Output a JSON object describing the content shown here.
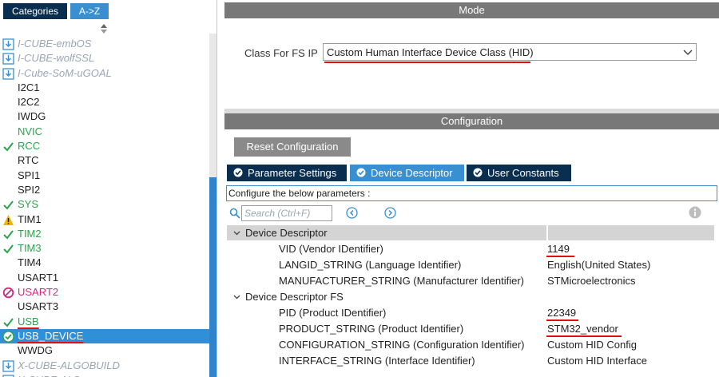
{
  "left_panel": {
    "tabs": [
      {
        "label": "Categories"
      },
      {
        "label": "A->Z"
      }
    ],
    "items": [
      {
        "label": "I-CUBE-embOS",
        "style": "gray",
        "icon": "download-icon"
      },
      {
        "label": "I-CUBE-wolfSSL",
        "style": "gray",
        "icon": "download-icon"
      },
      {
        "label": "I-Cube-SoM-uGOAL",
        "style": "gray",
        "icon": "download-icon"
      },
      {
        "label": "I2C1",
        "style": "normal",
        "icon": ""
      },
      {
        "label": "I2C2",
        "style": "normal",
        "icon": ""
      },
      {
        "label": "IWDG",
        "style": "normal",
        "icon": ""
      },
      {
        "label": "NVIC",
        "style": "green",
        "icon": ""
      },
      {
        "label": "RCC",
        "style": "green",
        "icon": "check-icon"
      },
      {
        "label": "RTC",
        "style": "normal",
        "icon": ""
      },
      {
        "label": "SPI1",
        "style": "normal",
        "icon": ""
      },
      {
        "label": "SPI2",
        "style": "normal",
        "icon": ""
      },
      {
        "label": "SYS",
        "style": "green",
        "icon": "check-icon"
      },
      {
        "label": "TIM1",
        "style": "normal",
        "icon": "warning-icon"
      },
      {
        "label": "TIM2",
        "style": "green",
        "icon": "check-icon"
      },
      {
        "label": "TIM3",
        "style": "green",
        "icon": "check-icon"
      },
      {
        "label": "TIM4",
        "style": "normal",
        "icon": ""
      },
      {
        "label": "USART1",
        "style": "normal",
        "icon": ""
      },
      {
        "label": "USART2",
        "style": "pink",
        "icon": "forbidden-icon"
      },
      {
        "label": "USART3",
        "style": "normal",
        "icon": ""
      },
      {
        "label": "USB",
        "style": "green",
        "icon": "check-icon"
      },
      {
        "label": "USB_DEVICE",
        "style": "selected",
        "icon": "check-circle-icon"
      },
      {
        "label": "WWDG",
        "style": "normal",
        "icon": ""
      },
      {
        "label": "X-CUBE-ALGOBUILD",
        "style": "gray",
        "icon": "download-icon"
      },
      {
        "label": "X-CUBE-ALS",
        "style": "gray",
        "icon": "download-icon"
      }
    ]
  },
  "mode": {
    "title": "Mode",
    "class_label": "Class For FS IP",
    "class_value": "Custom Human Interface Device Class (HID)"
  },
  "configuration": {
    "title": "Configuration",
    "reset_button": "Reset Configuration",
    "tabs": [
      {
        "label": "Parameter Settings"
      },
      {
        "label": "Device Descriptor"
      },
      {
        "label": "User Constants"
      }
    ],
    "active_tab": "Device Descriptor",
    "description": "Configure the below parameters :",
    "search_placeholder": "Search (Ctrl+F)",
    "groups": [
      {
        "name": "Device Descriptor",
        "rows": [
          {
            "name": "VID (Vendor IDentifier)",
            "value": "1149"
          },
          {
            "name": "LANGID_STRING (Language Identifier)",
            "value": "English(United States)"
          },
          {
            "name": "MANUFACTURER_STRING (Manufacturer Identifier)",
            "value": "STMicroelectronics"
          }
        ]
      },
      {
        "name": "Device Descriptor FS",
        "rows": [
          {
            "name": "PID (Product IDentifier)",
            "value": "22349"
          },
          {
            "name": "PRODUCT_STRING (Product Identifier)",
            "value": "STM32_vendor"
          },
          {
            "name": "CONFIGURATION_STRING (Configuration Identifier)",
            "value": "Custom HID Config"
          },
          {
            "name": "INTERFACE_STRING (Interface Identifier)",
            "value": "Custom HID Interface"
          }
        ]
      }
    ]
  },
  "colors": {
    "navy": "#0a2e4f",
    "accent_blue": "#3a8fd0",
    "green": "#2aa44a",
    "pink": "#e0237d",
    "annotation_red": "#e01010"
  }
}
